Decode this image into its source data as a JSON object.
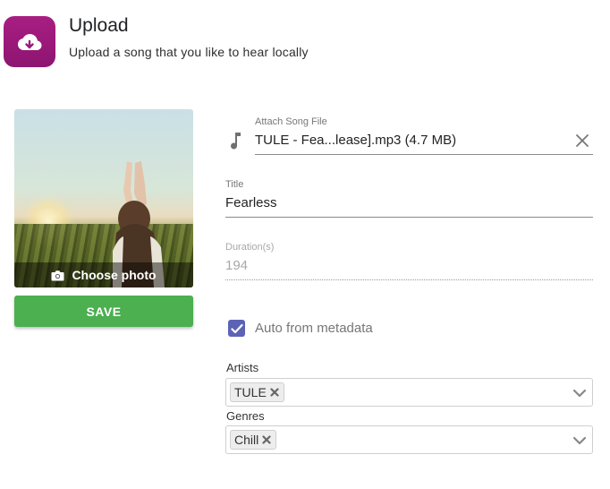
{
  "header": {
    "title": "Upload",
    "subtitle": "Upload a song that you like to hear locally",
    "icon": "cloud-upload-icon",
    "icon_color": "#9b1a7b"
  },
  "photo": {
    "choose_label": "Choose photo",
    "icon": "camera-icon"
  },
  "actions": {
    "save_label": "SAVE",
    "save_color": "#4caf50"
  },
  "form": {
    "attach": {
      "label": "Attach Song File",
      "value": "TULE - Fea...lease].mp3 (4.7 MB)",
      "icon": "music-note-icon",
      "clear_icon": "close-icon"
    },
    "title": {
      "label": "Title",
      "value": "Fearless"
    },
    "duration": {
      "label": "Duration(s)",
      "value": "194"
    },
    "auto_metadata": {
      "label": "Auto from metadata",
      "checked": true,
      "color": "#5c63b5"
    },
    "artists": {
      "label": "Artists",
      "chips": [
        "TULE"
      ]
    },
    "genres": {
      "label": "Genres",
      "chips": [
        "Chill"
      ]
    }
  }
}
